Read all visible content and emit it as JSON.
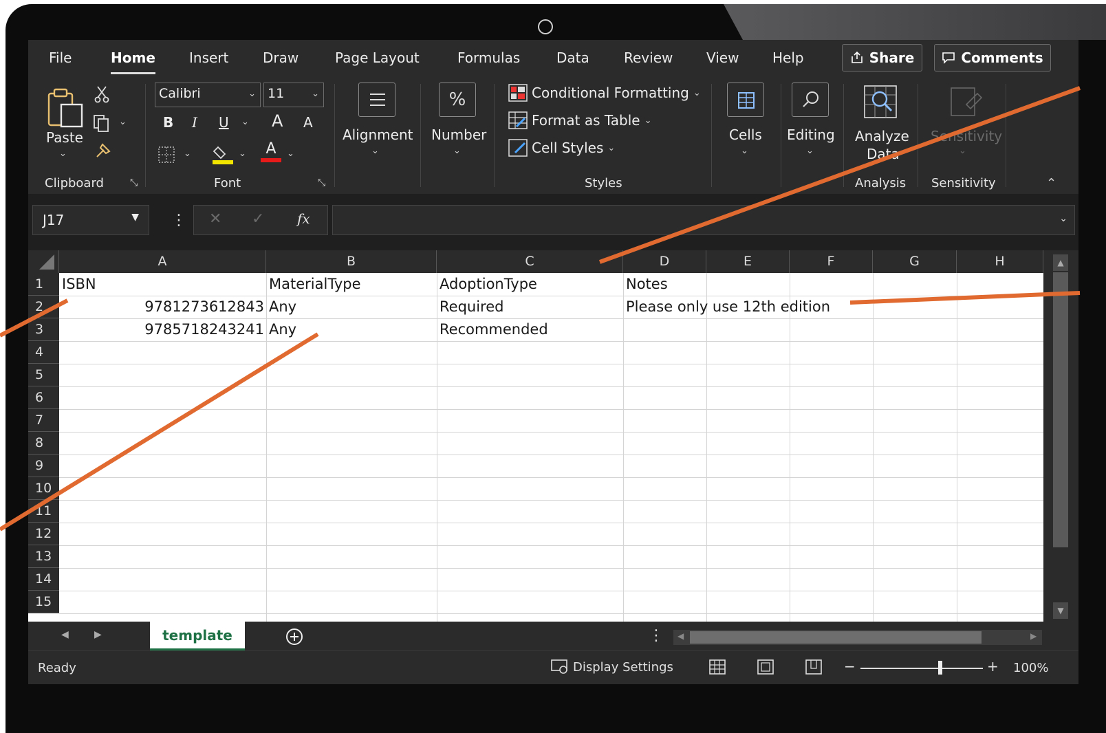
{
  "menu": {
    "tabs": [
      "File",
      "Home",
      "Insert",
      "Draw",
      "Page Layout",
      "Formulas",
      "Data",
      "Review",
      "View",
      "Help"
    ],
    "share": "Share",
    "comments": "Comments"
  },
  "ribbon": {
    "clipboard": {
      "paste": "Paste",
      "label": "Clipboard"
    },
    "font": {
      "name": "Calibri",
      "size": "11",
      "bold": "B",
      "italic": "I",
      "underline": "U",
      "grow": "A",
      "shrink": "A",
      "font_color": "A",
      "label": "Font"
    },
    "alignment": {
      "label": "Alignment"
    },
    "number": {
      "label": "Number",
      "glyph": "%"
    },
    "styles": {
      "conditional": "Conditional Formatting",
      "format_table": "Format as Table",
      "cell_styles": "Cell Styles",
      "label": "Styles"
    },
    "cells": {
      "label": "Cells"
    },
    "editing": {
      "label": "Editing"
    },
    "analysis": {
      "analyze_line1": "Analyze",
      "analyze_line2": "Data",
      "label": "Analysis"
    },
    "sensitivity": {
      "button": "Sensitivity",
      "label": "Sensitivity"
    }
  },
  "formula_bar": {
    "name_box": "J17",
    "fx": "fx",
    "value": ""
  },
  "sheet": {
    "columns": [
      "A",
      "B",
      "C",
      "D",
      "E",
      "F",
      "G",
      "H"
    ],
    "rows": [
      "1",
      "2",
      "3",
      "4",
      "5",
      "6",
      "7",
      "8",
      "9",
      "10",
      "11",
      "12",
      "13",
      "14",
      "15"
    ],
    "cells": {
      "A1": "ISBN",
      "B1": "MaterialType",
      "C1": "AdoptionType",
      "D1": "Notes",
      "A2": "9781273612843",
      "B2": "Any",
      "C2": "Required",
      "D2": "Please only use 12th edition",
      "A3": "9785718243241",
      "B3": "Any",
      "C3": "Recommended"
    }
  },
  "tabs": {
    "sheet_name": "template"
  },
  "status": {
    "ready": "Ready",
    "display_settings": "Display Settings",
    "zoom": "100%",
    "zoom_level_pct": 65
  },
  "colors": {
    "callout": "#e06a30",
    "accent_green": "#1e7145"
  }
}
